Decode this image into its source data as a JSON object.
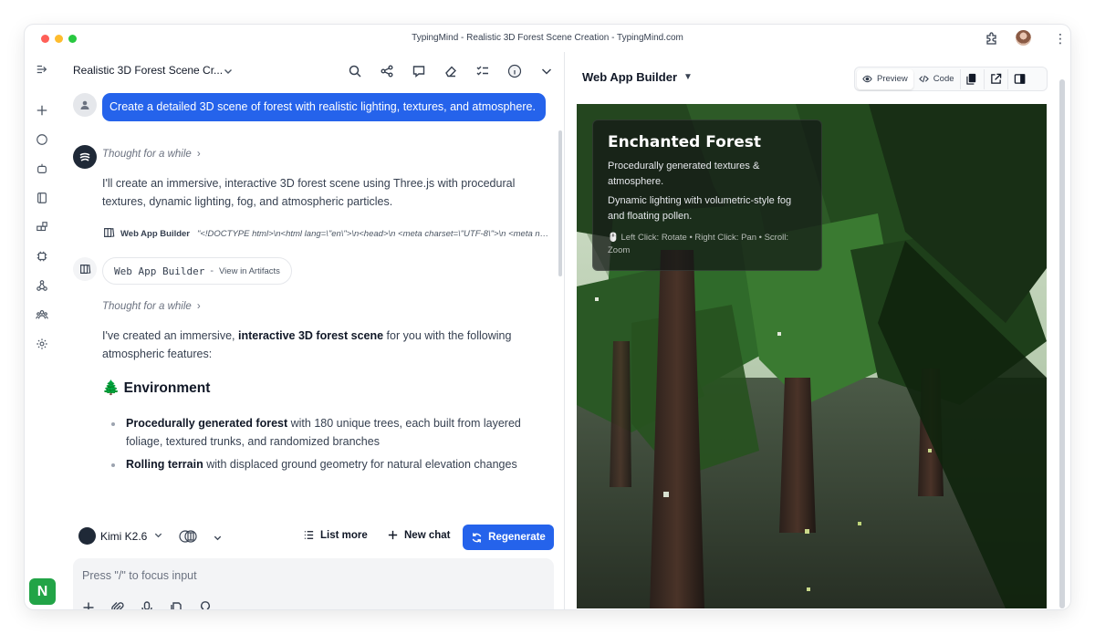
{
  "window": {
    "title": "TypingMind - Realistic 3D Forest Scene Creation - TypingMind.com"
  },
  "icons": {
    "titlebar": [
      "extension-icon",
      "avatar",
      "more-vertical-icon"
    ],
    "rail": [
      "collapse-sidebar-icon",
      "plus-icon",
      "chat-icon",
      "agents-icon",
      "prompts-icon",
      "plugins-icon",
      "models-icon",
      "kb-icon",
      "team-icon",
      "settings-icon"
    ],
    "header": [
      "search-icon",
      "share-icon",
      "comment-icon",
      "eraser-icon",
      "checklist-icon",
      "info-icon",
      "chevron-down-icon"
    ]
  },
  "rail": {
    "logo": "N"
  },
  "chat": {
    "title": "Realistic 3D Forest Scene Cr...",
    "user_message": "Create a detailed 3D scene of forest with realistic lighting, textures, and atmosphere.",
    "thought_1": "Thought for a while",
    "reply_1": "I'll create an immersive, interactive 3D forest scene using Three.js with procedural textures, dynamic lighting, fog, and atmospheric particles.",
    "tool": {
      "name": "Web App Builder",
      "code": "\"<!DOCTYPE html>\\n<html lang=\\\"en\\\">\\n<head>\\n  <meta charset=\\\"UTF-8\\\">\\n  <meta name=\\\"viewport\\\" content=\\\"width=device-width\\\">"
    },
    "artifact": {
      "name": "Web App Builder",
      "sep": "-",
      "link": "View in Artifacts"
    },
    "thought_2": "Thought for a while",
    "reply_2_pre": "I've created an immersive, ",
    "reply_2_bold": "interactive 3D forest scene",
    "reply_2_post": " for you with the following atmospheric features:",
    "section_emoji": "🌲",
    "section_heading": "Environment",
    "bullets": [
      {
        "bold": "Procedurally generated forest",
        "text": " with 180 unique trees, each built from layered foliage, textured trunks, and randomized branches"
      },
      {
        "bold": "Rolling terrain",
        "text": " with displaced ground geometry for natural elevation changes"
      }
    ]
  },
  "bottom": {
    "model": "Kimi K2.6",
    "list_more": "List more",
    "new_chat": "New chat",
    "regenerate": "Regenerate",
    "input_placeholder": "Press \"/\" to focus input"
  },
  "panel": {
    "title": "Web App Builder",
    "tabs": {
      "preview": "Preview",
      "code": "Code"
    },
    "overlay": {
      "title": "Enchanted Forest",
      "p1": "Procedurally generated textures & atmosphere.",
      "p2": "Dynamic lighting with volumetric-style fog and floating pollen.",
      "controls": "🖱️ Left Click: Rotate • Right Click: Pan • Scroll: Zoom"
    }
  },
  "colors": {
    "accent": "#2563eb",
    "brand_green": "#22a447"
  }
}
